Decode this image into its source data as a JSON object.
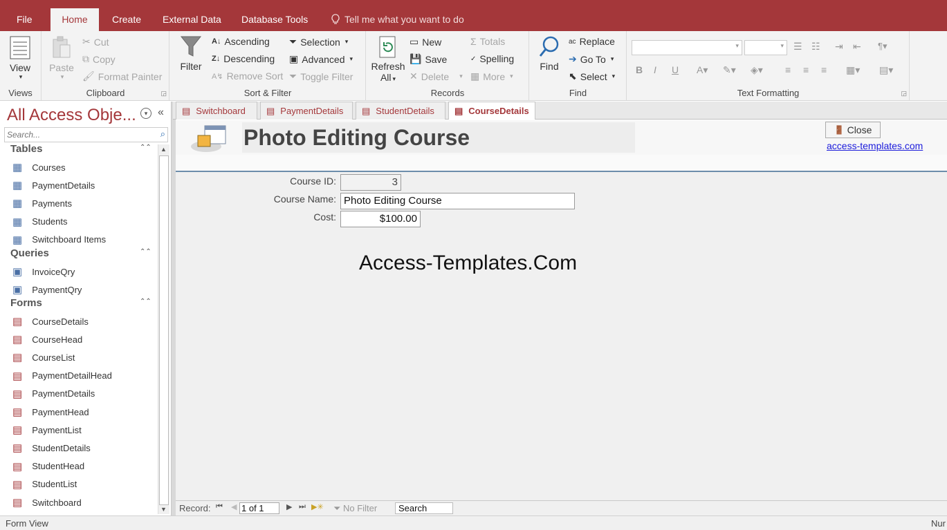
{
  "ribbon_tabs": [
    "File",
    "Home",
    "Create",
    "External Data",
    "Database Tools"
  ],
  "tell_me": "Tell me what you want to do",
  "groups": {
    "views": {
      "label": "Views",
      "view": "View"
    },
    "clipboard": {
      "label": "Clipboard",
      "paste": "Paste",
      "cut": "Cut",
      "copy": "Copy",
      "format_painter": "Format Painter"
    },
    "sort_filter": {
      "label": "Sort & Filter",
      "filter": "Filter",
      "ascending": "Ascending",
      "descending": "Descending",
      "remove_sort": "Remove Sort",
      "selection": "Selection",
      "advanced": "Advanced",
      "toggle_filter": "Toggle Filter"
    },
    "records": {
      "label": "Records",
      "refresh": "Refresh",
      "refresh_all": "All",
      "new": "New",
      "save": "Save",
      "delete": "Delete",
      "totals": "Totals",
      "spelling": "Spelling",
      "more": "More"
    },
    "find": {
      "label": "Find",
      "find": "Find",
      "replace": "Replace",
      "goto": "Go To",
      "select": "Select"
    },
    "text_formatting": {
      "label": "Text Formatting",
      "bold": "B",
      "italic": "I",
      "underline": "U"
    }
  },
  "nav": {
    "title": "All Access Obje...",
    "search_placeholder": "Search...",
    "sections": [
      {
        "name": "Tables",
        "items": [
          "Courses",
          "PaymentDetails",
          "Payments",
          "Students",
          "Switchboard Items"
        ]
      },
      {
        "name": "Queries",
        "items": [
          "InvoiceQry",
          "PaymentQry"
        ]
      },
      {
        "name": "Forms",
        "items": [
          "CourseDetails",
          "CourseHead",
          "CourseList",
          "PaymentDetailHead",
          "PaymentDetails",
          "PaymentHead",
          "PaymentList",
          "StudentDetails",
          "StudentHead",
          "StudentList",
          "Switchboard"
        ]
      }
    ]
  },
  "doc_tabs": [
    "Switchboard",
    "PaymentDetails",
    "StudentDetails",
    "CourseDetails"
  ],
  "form": {
    "title": "Photo Editing Course",
    "close_label": "Close",
    "link": "access-templates.com",
    "fields": [
      {
        "label": "Course ID:",
        "value": "3"
      },
      {
        "label": "Course Name:",
        "value": "Photo Editing Course"
      },
      {
        "label": "Cost:",
        "value": "$100.00"
      }
    ],
    "watermark": "Access-Templates.Com"
  },
  "record_nav": {
    "label": "Record:",
    "position": "1 of 1",
    "filter": "No Filter",
    "search": "Search"
  },
  "status": {
    "left": "Form View",
    "right": "Nur"
  },
  "colors": {
    "accent": "#a4373a"
  }
}
